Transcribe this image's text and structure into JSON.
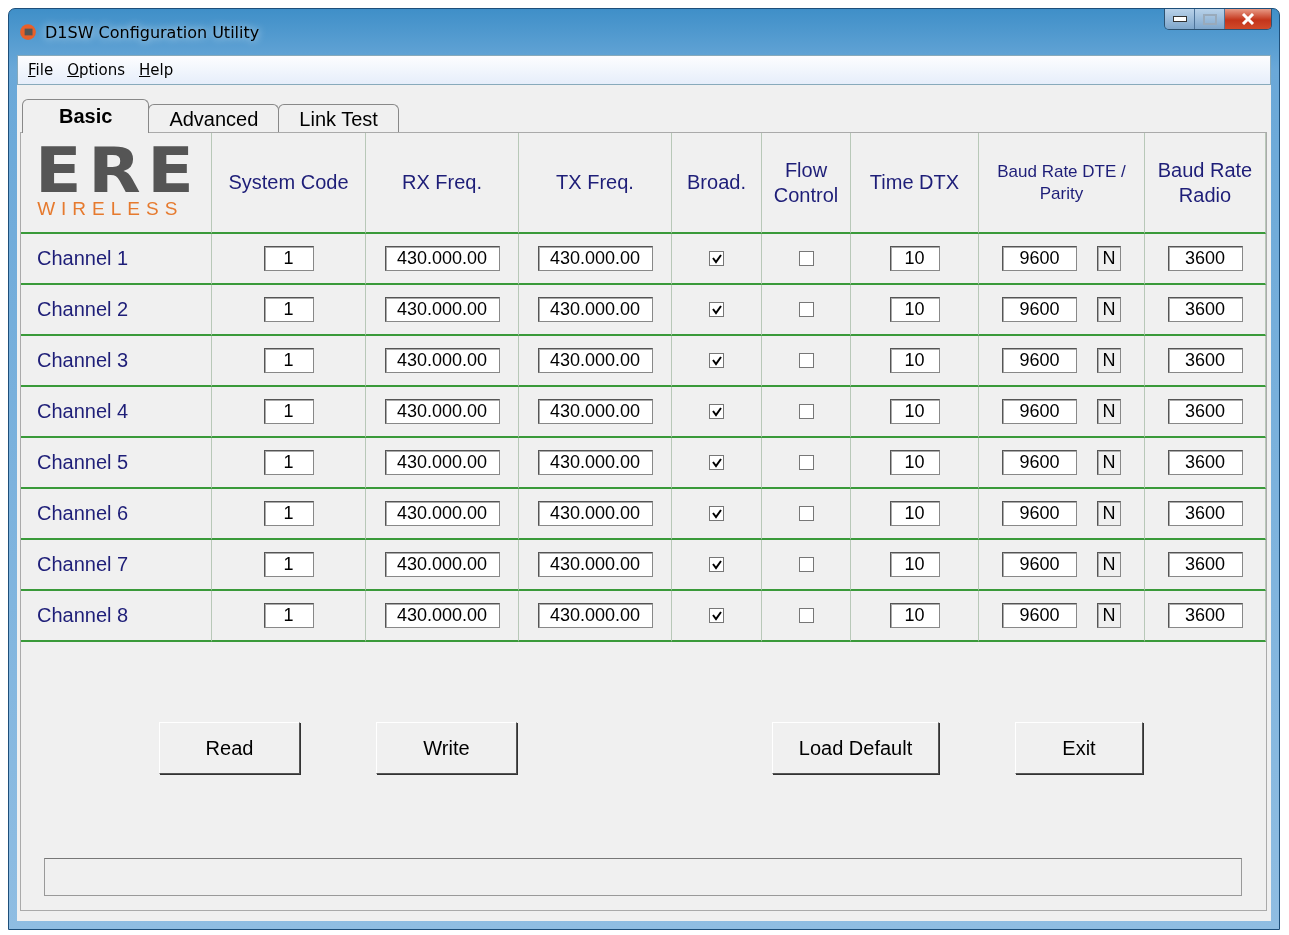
{
  "window": {
    "title": "D1SW Configuration Utility"
  },
  "menu": [
    {
      "label": "File"
    },
    {
      "label": "Options"
    },
    {
      "label": "Help"
    }
  ],
  "tabs": [
    {
      "label": "Basic",
      "selected": true
    },
    {
      "label": "Advanced",
      "selected": false
    },
    {
      "label": "Link Test",
      "selected": false
    }
  ],
  "logo": {
    "mark": "ERE",
    "sub": "WIRELESS"
  },
  "table": {
    "columns": [
      "System Code",
      "RX Freq.",
      "TX Freq.",
      "Broad.",
      "Flow Control",
      "Time DTX",
      "Baud Rate DTE / Parity",
      "Baud Rate Radio"
    ],
    "rows": [
      {
        "name": "Channel 1",
        "system_code": "1",
        "rx_freq": "430.000.00",
        "tx_freq": "430.000.00",
        "broad": true,
        "flow_control": false,
        "time_dtx": "10",
        "baud_dte": "9600",
        "parity": "N",
        "baud_radio": "3600"
      },
      {
        "name": "Channel 2",
        "system_code": "1",
        "rx_freq": "430.000.00",
        "tx_freq": "430.000.00",
        "broad": true,
        "flow_control": false,
        "time_dtx": "10",
        "baud_dte": "9600",
        "parity": "N",
        "baud_radio": "3600"
      },
      {
        "name": "Channel 3",
        "system_code": "1",
        "rx_freq": "430.000.00",
        "tx_freq": "430.000.00",
        "broad": true,
        "flow_control": false,
        "time_dtx": "10",
        "baud_dte": "9600",
        "parity": "N",
        "baud_radio": "3600"
      },
      {
        "name": "Channel 4",
        "system_code": "1",
        "rx_freq": "430.000.00",
        "tx_freq": "430.000.00",
        "broad": true,
        "flow_control": false,
        "time_dtx": "10",
        "baud_dte": "9600",
        "parity": "N",
        "baud_radio": "3600"
      },
      {
        "name": "Channel 5",
        "system_code": "1",
        "rx_freq": "430.000.00",
        "tx_freq": "430.000.00",
        "broad": true,
        "flow_control": false,
        "time_dtx": "10",
        "baud_dte": "9600",
        "parity": "N",
        "baud_radio": "3600"
      },
      {
        "name": "Channel 6",
        "system_code": "1",
        "rx_freq": "430.000.00",
        "tx_freq": "430.000.00",
        "broad": true,
        "flow_control": false,
        "time_dtx": "10",
        "baud_dte": "9600",
        "parity": "N",
        "baud_radio": "3600"
      },
      {
        "name": "Channel 7",
        "system_code": "1",
        "rx_freq": "430.000.00",
        "tx_freq": "430.000.00",
        "broad": true,
        "flow_control": false,
        "time_dtx": "10",
        "baud_dte": "9600",
        "parity": "N",
        "baud_radio": "3600"
      },
      {
        "name": "Channel 8",
        "system_code": "1",
        "rx_freq": "430.000.00",
        "tx_freq": "430.000.00",
        "broad": true,
        "flow_control": false,
        "time_dtx": "10",
        "baud_dte": "9600",
        "parity": "N",
        "baud_radio": "3600"
      }
    ]
  },
  "buttons": [
    "Read",
    "Write",
    "Load Default",
    "Exit"
  ]
}
